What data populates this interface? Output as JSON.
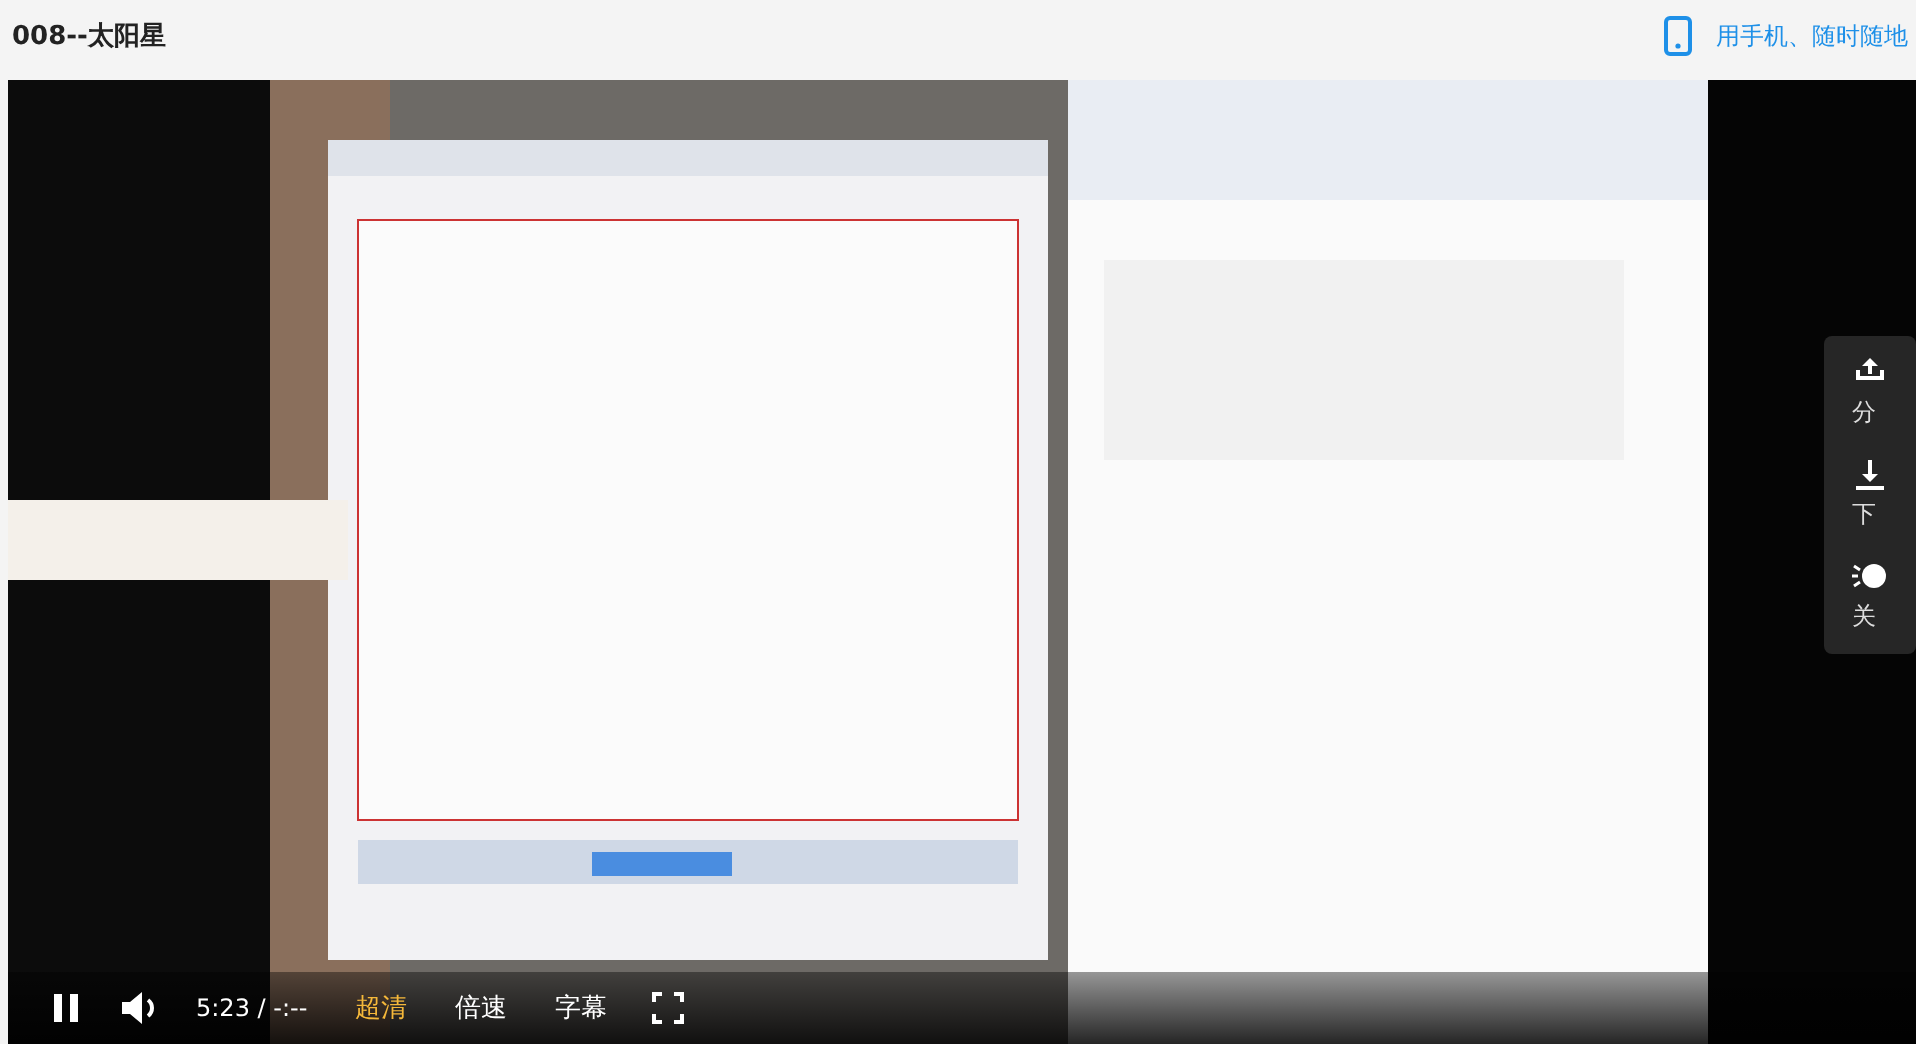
{
  "page": {
    "title": "008--太阳星",
    "mobile_link": "用手机、随时随地"
  },
  "side_panel": [
    {
      "kind": "share",
      "label": "分"
    },
    {
      "kind": "download",
      "label": "下"
    },
    {
      "kind": "light",
      "label": "关"
    }
  ],
  "controls": {
    "playing": true,
    "time": "5:23 / -:--",
    "quality": "超清",
    "speed": "倍速",
    "subtitles": "字幕"
  }
}
